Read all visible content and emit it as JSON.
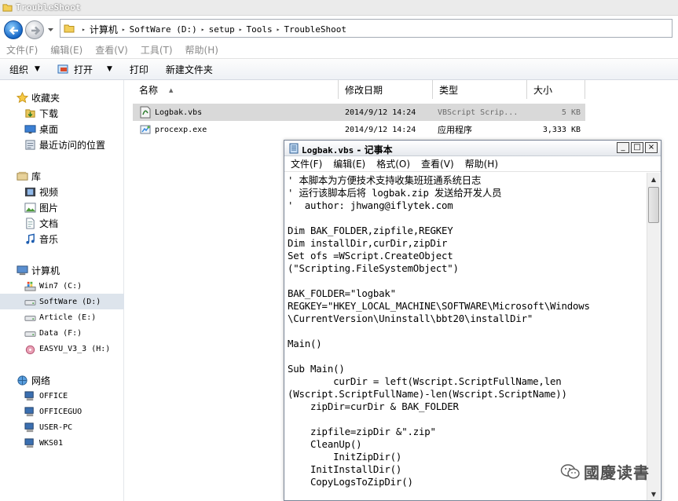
{
  "window": {
    "title": "TroubleShoot"
  },
  "address_bar": {
    "breadcrumbs": [
      "计算机",
      "SoftWare (D:)",
      "setup",
      "Tools",
      "TroubleShoot"
    ]
  },
  "menu": [
    "文件(F)",
    "编辑(E)",
    "查看(V)",
    "工具(T)",
    "帮助(H)"
  ],
  "command_bar": {
    "organize": "组织",
    "open": "打开",
    "print": "打印",
    "new_folder": "新建文件夹"
  },
  "nav_tree": {
    "favorites": {
      "label": "收藏夹",
      "items": [
        "下载",
        "桌面",
        "最近访问的位置"
      ]
    },
    "libraries": {
      "label": "库",
      "items": [
        "视频",
        "图片",
        "文档",
        "音乐"
      ]
    },
    "computer": {
      "label": "计算机",
      "drives": [
        "Win7 (C:)",
        "SoftWare (D:)",
        "Article (E:)",
        "Data (F:)",
        "EASYU_V3_3 (H:)"
      ],
      "selected": "SoftWare (D:)"
    },
    "network": {
      "label": "网络",
      "hosts": [
        "OFFICE",
        "OFFICEGUO",
        "USER-PC",
        "WKS01"
      ]
    }
  },
  "columns": {
    "name": "名称",
    "modified": "修改日期",
    "type": "类型",
    "size": "大小"
  },
  "files": [
    {
      "name": "Logbak.vbs",
      "modified": "2014/9/12 14:24",
      "type": "VBScript Scrip...",
      "size": "5 KB",
      "selected": true,
      "icon": "vbs-script-icon"
    },
    {
      "name": "procexp.exe",
      "modified": "2014/9/12 14:24",
      "type": "应用程序",
      "size": "3,333 KB",
      "selected": false,
      "icon": "exe-app-icon"
    }
  ],
  "notepad": {
    "title_file": "Logbak.vbs",
    "title_sep": " - ",
    "title_app": "记事本",
    "menu": [
      "文件(F)",
      "编辑(E)",
      "格式(O)",
      "查看(V)",
      "帮助(H)"
    ],
    "lines": [
      "' 本脚本为方便技术支持收集班班通系统日志",
      "' 运行该脚本后将 logbak.zip 发送给开发人员",
      "'  author: jhwang@iflytek.com",
      "",
      "Dim BAK_FOLDER,zipfile,REGKEY",
      "Dim installDir,curDir,zipDir",
      "Set ofs =WScript.CreateObject",
      "(\"Scripting.FileSystemObject\")",
      "",
      "BAK_FOLDER=\"logbak\"",
      "REGKEY=\"HKEY_LOCAL_MACHINE\\SOFTWARE\\Microsoft\\Windows",
      "\\CurrentVersion\\Uninstall\\bbt20\\installDir\"",
      "",
      "Main()",
      "",
      "Sub Main()",
      "        curDir = left(Wscript.ScriptFullName,len",
      "(Wscript.ScriptFullName)-len(Wscript.ScriptName))",
      "    zipDir=curDir & BAK_FOLDER",
      "",
      "    zipfile=zipDir &\".zip\"",
      "    CleanUp()",
      "        InitZipDir()",
      "    InitInstallDir()",
      "    CopyLogsToZipDir()"
    ]
  },
  "watermark": {
    "text": "國慶读書"
  }
}
